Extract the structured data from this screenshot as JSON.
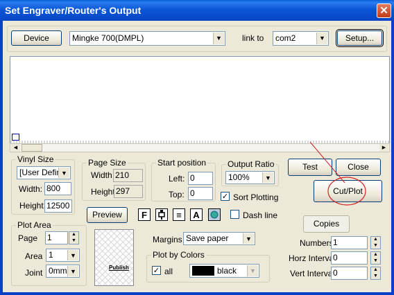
{
  "window": {
    "title": "Set Engraver/Router's Output",
    "close_glyph": "✕"
  },
  "device": {
    "button_label": "Device",
    "model_value": "Mingke 700(DMPL)",
    "link_label": "link to",
    "port_value": "com2",
    "setup_label": "Setup..."
  },
  "vinyl": {
    "title": "Vinyl Size",
    "preset_value": "[User Define",
    "width_label": "Width:",
    "width_value": "800",
    "height_label": "Height:",
    "height_value": "12500"
  },
  "page_size": {
    "title": "Page Size",
    "width_label": "Width",
    "width_value": "210",
    "height_label": "Height",
    "height_value": "297"
  },
  "start_position": {
    "title": "Start position",
    "left_label": "Left:",
    "left_value": "0",
    "top_label": "Top:",
    "top_value": "0"
  },
  "output_ratio": {
    "title": "Output Ratio",
    "value": "100%"
  },
  "sort_plotting": {
    "label": "Sort Plotting",
    "checked": "✓"
  },
  "actions": {
    "test_label": "Test",
    "close_label": "Close",
    "cutplot_label": "Cut/Plot"
  },
  "preview": {
    "button_label": "Preview",
    "thumb_text": "Publish"
  },
  "tools": {
    "font_glyph": "F",
    "align_glyph": "≡",
    "text_glyph": "A"
  },
  "dash_line": {
    "label": "Dash line"
  },
  "plot_area": {
    "title": "Plot Area",
    "page_label": "Page",
    "page_value": "1",
    "area_label": "Area",
    "area_value": "1",
    "joint_label": "Joint",
    "joint_value": "0mm"
  },
  "margins": {
    "label": "Margins",
    "value": "Save paper"
  },
  "plot_by_colors": {
    "title": "Plot by Colors",
    "all_label": "all",
    "all_checked": "✓",
    "color_name": "black",
    "swatch_color": "#000000"
  },
  "copies": {
    "tab_label": "Copies",
    "numbers_label": "Numbers",
    "numbers_value": "1",
    "horz_label": "Horz Interval",
    "horz_value": "0",
    "vert_label": "Vert Interval",
    "vert_value": "0"
  },
  "colors": {
    "annotation": "#d42020"
  }
}
